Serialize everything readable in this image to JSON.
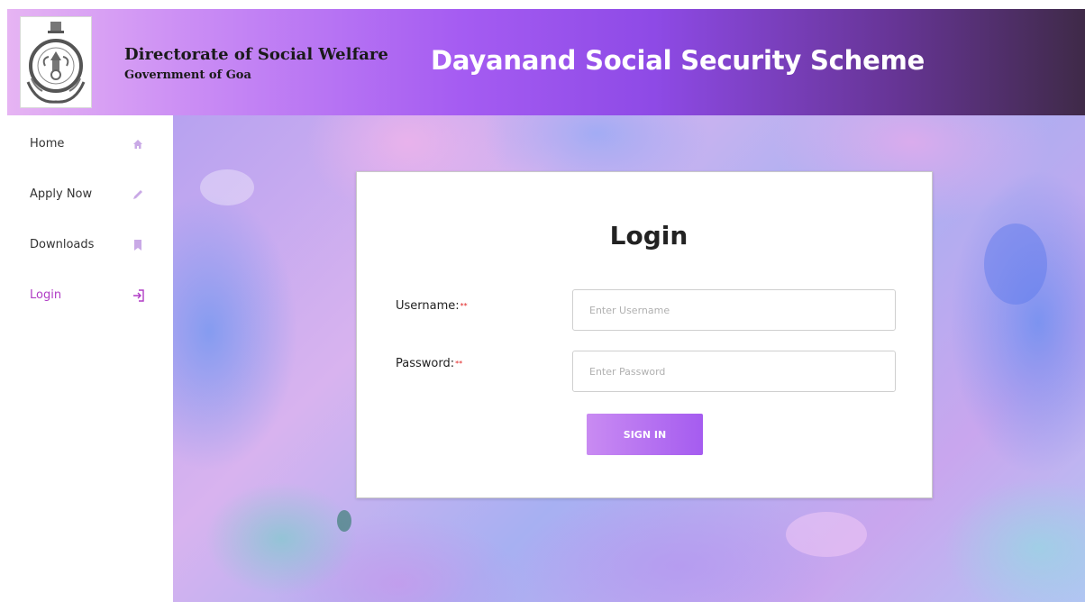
{
  "header": {
    "org_title": "Directorate of Social Welfare",
    "org_subtitle": "Government of Goa",
    "scheme_title": "Dayanand Social Security Scheme",
    "emblem_icon": "government-of-goa-emblem"
  },
  "sidebar": {
    "items": [
      {
        "label": "Home",
        "icon": "home-icon",
        "active": false
      },
      {
        "label": "Apply Now",
        "icon": "pencil-icon",
        "active": false
      },
      {
        "label": "Downloads",
        "icon": "bookmark-icon",
        "active": false
      },
      {
        "label": "Login",
        "icon": "login-icon",
        "active": true
      }
    ]
  },
  "login": {
    "title": "Login",
    "username_label": "Username:",
    "username_placeholder": "Enter Username",
    "password_label": "Password:",
    "password_placeholder": "Enter Password",
    "required_mark": "**",
    "signin_label": "SIGN IN"
  },
  "colors": {
    "accent": "#a55cf0",
    "active_nav": "#b03cc5",
    "required": "#e02020"
  }
}
